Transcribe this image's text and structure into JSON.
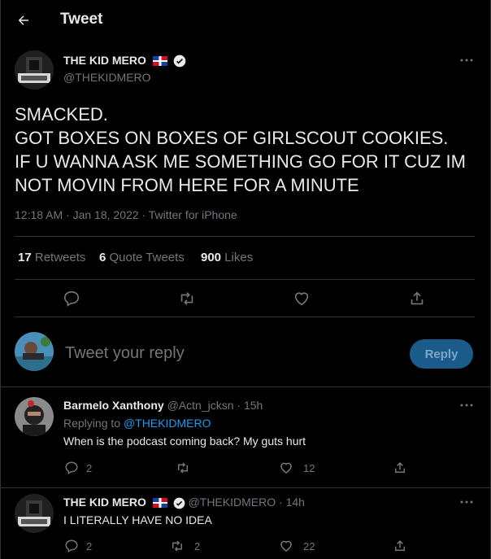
{
  "header": {
    "title": "Tweet"
  },
  "tweet": {
    "author_name": "THE KID MERO",
    "author_handle": "@THEKIDMERO",
    "text_lines": [
      "SMACKED.",
      "GOT BOXES ON BOXES OF GIRLSCOUT COOKIES.",
      "IF U WANNA ASK ME SOMETHING GO FOR IT CUZ IM",
      "NOT MOVIN FROM HERE FOR A MINUTE"
    ],
    "meta": "12:18 AM · Jan 18, 2022 · Twitter for iPhone",
    "stats": {
      "retweets_count": "17",
      "retweets_label": "Retweets",
      "quotes_count": "6",
      "quotes_label": "Quote Tweets",
      "likes_count": "900",
      "likes_label": "Likes"
    }
  },
  "composer": {
    "placeholder": "Tweet your reply",
    "reply_button": "Reply"
  },
  "replies": [
    {
      "author_name": "Barmelo Xanthony",
      "author_handle": "@Actn_jcksn",
      "time": "· 15h",
      "replying_prefix": "Replying to",
      "replying_to": "@THEKIDMERO",
      "text": "When is the podcast coming back? My guts hurt",
      "reply_count": "2",
      "retweet_count": "",
      "like_count": "12"
    },
    {
      "author_name": "THE KID MERO",
      "author_handle": "@THEKIDMERO",
      "time": "· 14h",
      "text": "I LITERALLY HAVE NO IDEA",
      "reply_count": "2",
      "retweet_count": "2",
      "like_count": "22"
    }
  ],
  "colors": {
    "background": "#000000",
    "accent": "#1d9bf0",
    "muted": "#71767b",
    "border": "#2f3336"
  }
}
